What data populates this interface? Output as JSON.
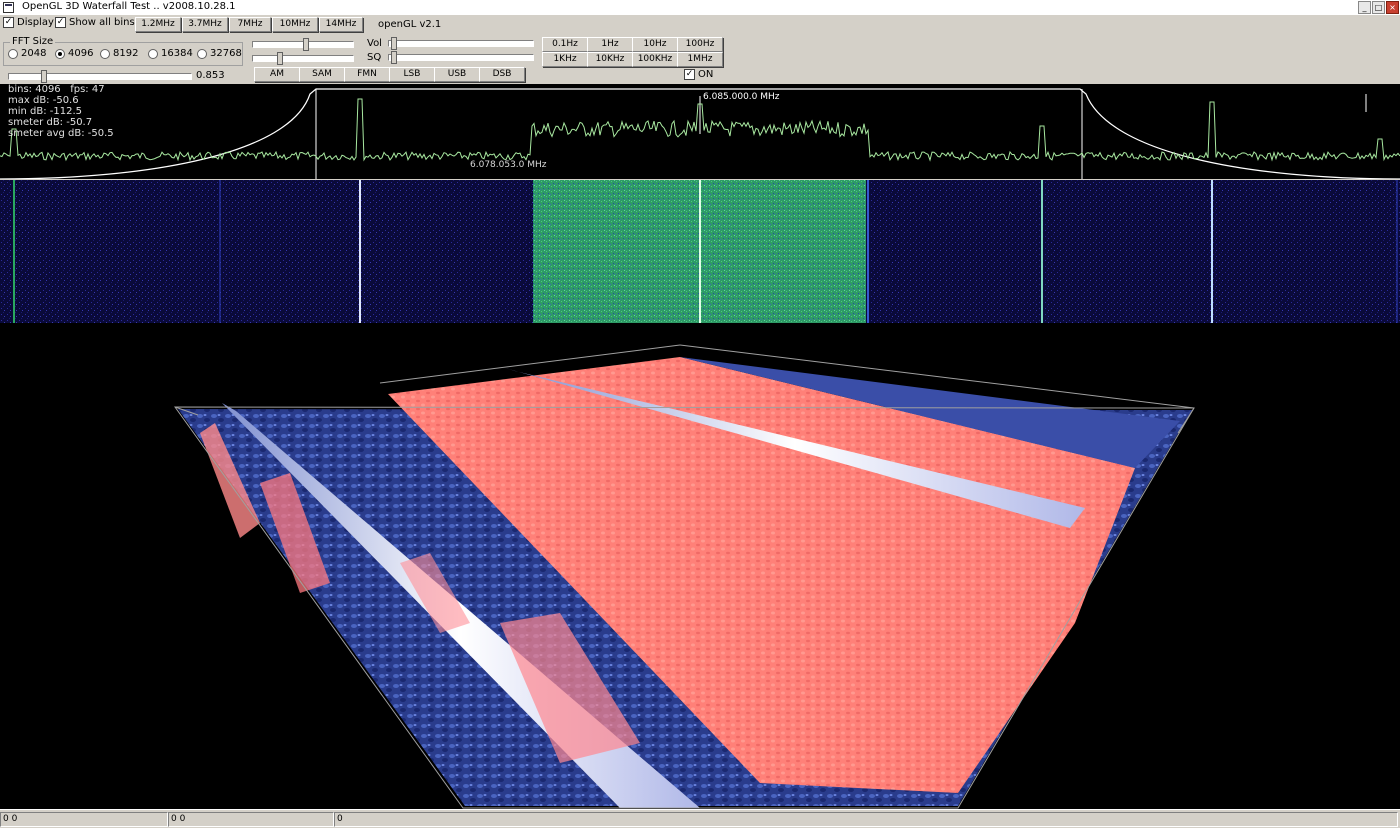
{
  "window": {
    "title": "OpenGL 3D Waterfall Test .. v2008.10.28.1"
  },
  "toolbar": {
    "display_label": "Display",
    "show_all_bins_label": "Show all bins",
    "band_buttons": [
      "1.2MHz",
      "3.7MHz",
      "7MHz",
      "10MHz",
      "14MHz"
    ],
    "opengl_version": "openGL v2.1",
    "fft_group_title": "FFT Size",
    "fft_sizes": [
      "2048",
      "4096",
      "8192",
      "16384",
      "32768"
    ],
    "fft_selected": "4096",
    "level_value": "0.853",
    "modes": [
      "AM",
      "SAM",
      "FMN",
      "LSB",
      "USB",
      "DSB"
    ],
    "vol_label": "Vol",
    "sq_label": "SQ",
    "step_row1": [
      "0.1Hz",
      "1Hz",
      "10Hz",
      "100Hz"
    ],
    "step_row2": [
      "1KHz",
      "10KHz",
      "100KHz",
      "1MHz"
    ],
    "on_label": "ON",
    "level_fraction": 0.02
  },
  "spectrum": {
    "readout": {
      "bins": "bins: 4096   fps: 47",
      "max_db": "max dB: -50.6",
      "min_db": "min dB: -112.5",
      "smeter_db": "smeter dB: -50.7",
      "smeter_avg_db": "smeter avg dB: -50.5"
    },
    "center_freq": "6.085.000.0 MHz",
    "marker_freq": "6.078.053.0 MHz"
  },
  "statusbar": {
    "panel1": "0 0",
    "panel2": "0 0",
    "panel3": "0"
  },
  "colors": {
    "trace": "#a8e8a0",
    "waterfall_bg": "#07072a",
    "waterfall_signal": "#2a9a60",
    "surface_low": "#3a50a8",
    "surface_high": "#ff8080",
    "ridge": "#ffffff"
  }
}
